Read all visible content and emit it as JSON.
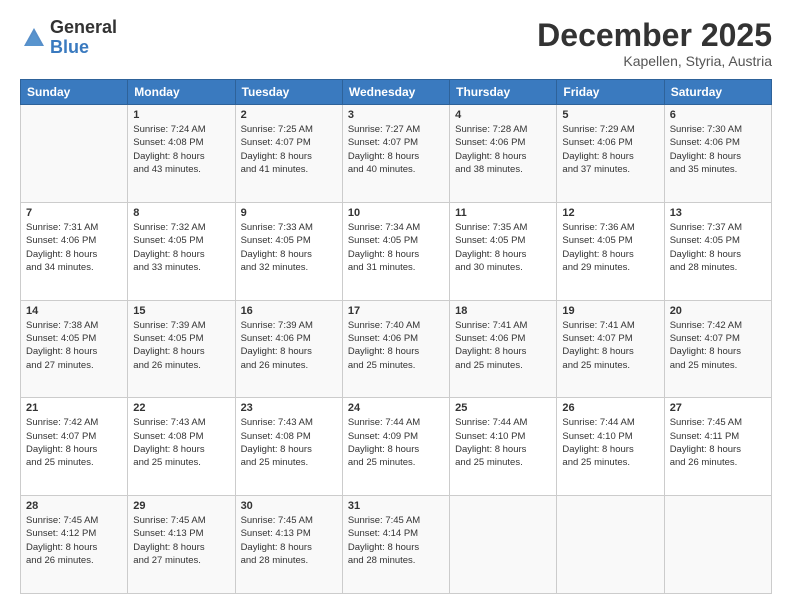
{
  "header": {
    "logo": {
      "general": "General",
      "blue": "Blue"
    },
    "title": "December 2025",
    "location": "Kapellen, Styria, Austria"
  },
  "calendar": {
    "days_of_week": [
      "Sunday",
      "Monday",
      "Tuesday",
      "Wednesday",
      "Thursday",
      "Friday",
      "Saturday"
    ],
    "weeks": [
      [
        {
          "day": "",
          "info": ""
        },
        {
          "day": "1",
          "info": "Sunrise: 7:24 AM\nSunset: 4:08 PM\nDaylight: 8 hours\nand 43 minutes."
        },
        {
          "day": "2",
          "info": "Sunrise: 7:25 AM\nSunset: 4:07 PM\nDaylight: 8 hours\nand 41 minutes."
        },
        {
          "day": "3",
          "info": "Sunrise: 7:27 AM\nSunset: 4:07 PM\nDaylight: 8 hours\nand 40 minutes."
        },
        {
          "day": "4",
          "info": "Sunrise: 7:28 AM\nSunset: 4:06 PM\nDaylight: 8 hours\nand 38 minutes."
        },
        {
          "day": "5",
          "info": "Sunrise: 7:29 AM\nSunset: 4:06 PM\nDaylight: 8 hours\nand 37 minutes."
        },
        {
          "day": "6",
          "info": "Sunrise: 7:30 AM\nSunset: 4:06 PM\nDaylight: 8 hours\nand 35 minutes."
        }
      ],
      [
        {
          "day": "7",
          "info": "Sunrise: 7:31 AM\nSunset: 4:06 PM\nDaylight: 8 hours\nand 34 minutes."
        },
        {
          "day": "8",
          "info": "Sunrise: 7:32 AM\nSunset: 4:05 PM\nDaylight: 8 hours\nand 33 minutes."
        },
        {
          "day": "9",
          "info": "Sunrise: 7:33 AM\nSunset: 4:05 PM\nDaylight: 8 hours\nand 32 minutes."
        },
        {
          "day": "10",
          "info": "Sunrise: 7:34 AM\nSunset: 4:05 PM\nDaylight: 8 hours\nand 31 minutes."
        },
        {
          "day": "11",
          "info": "Sunrise: 7:35 AM\nSunset: 4:05 PM\nDaylight: 8 hours\nand 30 minutes."
        },
        {
          "day": "12",
          "info": "Sunrise: 7:36 AM\nSunset: 4:05 PM\nDaylight: 8 hours\nand 29 minutes."
        },
        {
          "day": "13",
          "info": "Sunrise: 7:37 AM\nSunset: 4:05 PM\nDaylight: 8 hours\nand 28 minutes."
        }
      ],
      [
        {
          "day": "14",
          "info": "Sunrise: 7:38 AM\nSunset: 4:05 PM\nDaylight: 8 hours\nand 27 minutes."
        },
        {
          "day": "15",
          "info": "Sunrise: 7:39 AM\nSunset: 4:05 PM\nDaylight: 8 hours\nand 26 minutes."
        },
        {
          "day": "16",
          "info": "Sunrise: 7:39 AM\nSunset: 4:06 PM\nDaylight: 8 hours\nand 26 minutes."
        },
        {
          "day": "17",
          "info": "Sunrise: 7:40 AM\nSunset: 4:06 PM\nDaylight: 8 hours\nand 25 minutes."
        },
        {
          "day": "18",
          "info": "Sunrise: 7:41 AM\nSunset: 4:06 PM\nDaylight: 8 hours\nand 25 minutes."
        },
        {
          "day": "19",
          "info": "Sunrise: 7:41 AM\nSunset: 4:07 PM\nDaylight: 8 hours\nand 25 minutes."
        },
        {
          "day": "20",
          "info": "Sunrise: 7:42 AM\nSunset: 4:07 PM\nDaylight: 8 hours\nand 25 minutes."
        }
      ],
      [
        {
          "day": "21",
          "info": "Sunrise: 7:42 AM\nSunset: 4:07 PM\nDaylight: 8 hours\nand 25 minutes."
        },
        {
          "day": "22",
          "info": "Sunrise: 7:43 AM\nSunset: 4:08 PM\nDaylight: 8 hours\nand 25 minutes."
        },
        {
          "day": "23",
          "info": "Sunrise: 7:43 AM\nSunset: 4:08 PM\nDaylight: 8 hours\nand 25 minutes."
        },
        {
          "day": "24",
          "info": "Sunrise: 7:44 AM\nSunset: 4:09 PM\nDaylight: 8 hours\nand 25 minutes."
        },
        {
          "day": "25",
          "info": "Sunrise: 7:44 AM\nSunset: 4:10 PM\nDaylight: 8 hours\nand 25 minutes."
        },
        {
          "day": "26",
          "info": "Sunrise: 7:44 AM\nSunset: 4:10 PM\nDaylight: 8 hours\nand 25 minutes."
        },
        {
          "day": "27",
          "info": "Sunrise: 7:45 AM\nSunset: 4:11 PM\nDaylight: 8 hours\nand 26 minutes."
        }
      ],
      [
        {
          "day": "28",
          "info": "Sunrise: 7:45 AM\nSunset: 4:12 PM\nDaylight: 8 hours\nand 26 minutes."
        },
        {
          "day": "29",
          "info": "Sunrise: 7:45 AM\nSunset: 4:13 PM\nDaylight: 8 hours\nand 27 minutes."
        },
        {
          "day": "30",
          "info": "Sunrise: 7:45 AM\nSunset: 4:13 PM\nDaylight: 8 hours\nand 28 minutes."
        },
        {
          "day": "31",
          "info": "Sunrise: 7:45 AM\nSunset: 4:14 PM\nDaylight: 8 hours\nand 28 minutes."
        },
        {
          "day": "",
          "info": ""
        },
        {
          "day": "",
          "info": ""
        },
        {
          "day": "",
          "info": ""
        }
      ]
    ]
  }
}
